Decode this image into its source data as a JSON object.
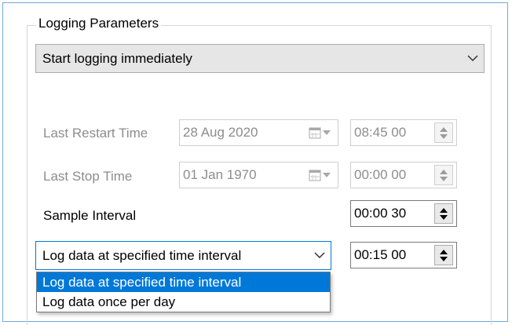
{
  "group": {
    "title": "Logging Parameters"
  },
  "mode_combo": {
    "value": "Start logging immediately"
  },
  "last_restart": {
    "label": "Last Restart Time",
    "date": "28 Aug 2020",
    "time": "08:45 00"
  },
  "last_stop": {
    "label": "Last Stop Time",
    "date": "01 Jan 1970",
    "time": "00:00 00"
  },
  "sample_interval": {
    "label": "Sample Interval",
    "time": "00:00 30"
  },
  "log_combo": {
    "value": "Log data at specified time interval",
    "time": "00:15 00"
  },
  "dropdown": {
    "options": [
      "Log data at specified time interval",
      "Log data once per day"
    ],
    "selected_index": 0
  },
  "colors": {
    "accent": "#0078d7",
    "disabled_text": "#8d8d8d",
    "combo_bg": "#e6e6e6"
  }
}
